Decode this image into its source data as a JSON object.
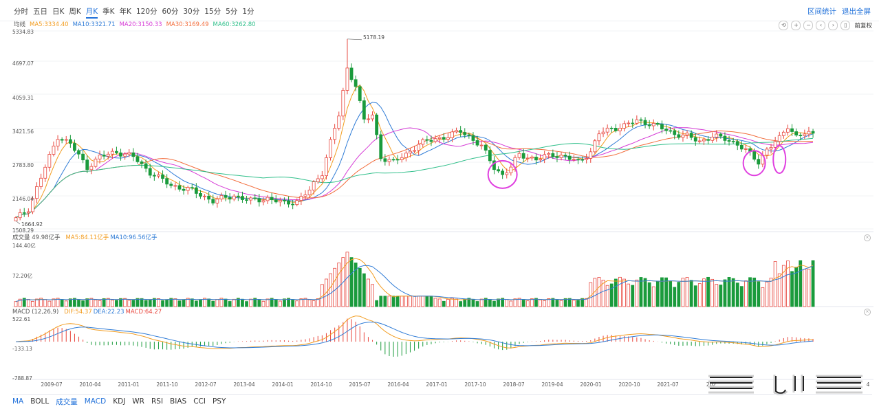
{
  "toolbar": {
    "periods": [
      {
        "label": "分时"
      },
      {
        "label": "五日"
      },
      {
        "label": "日K"
      },
      {
        "label": "周K"
      },
      {
        "label": "月K",
        "active": true
      },
      {
        "label": "季K"
      },
      {
        "label": "年K"
      },
      {
        "label": "120分"
      },
      {
        "label": "60分"
      },
      {
        "label": "30分"
      },
      {
        "label": "15分"
      },
      {
        "label": "5分"
      },
      {
        "label": "1分"
      }
    ],
    "range_stats": "区间统计",
    "exit_fullscreen": "退出全屏"
  },
  "ma_legend": {
    "title": "均线",
    "items": [
      {
        "text": "MA5:3334.40",
        "color": "#f29b1d"
      },
      {
        "text": "MA10:3321.71",
        "color": "#2e7bd6"
      },
      {
        "text": "MA20:3150.33",
        "color": "#d63bd6"
      },
      {
        "text": "MA30:3169.49",
        "color": "#f26b3a"
      },
      {
        "text": "MA60:3262.80",
        "color": "#2fbf8a"
      }
    ]
  },
  "tools": {
    "icons": [
      "undo-icon",
      "zoom-in-icon",
      "zoom-out-icon",
      "prev-icon",
      "next-icon",
      "reset-icon"
    ],
    "glyphs": [
      "⟲",
      "+",
      "−",
      "‹",
      "›",
      "▯"
    ],
    "adjust_label": "前复权"
  },
  "price_axis": [
    "5334.83",
    "4697.07",
    "4059.31",
    "3421.56",
    "2783.80",
    "2146.04",
    "1508.29"
  ],
  "price_notes": {
    "high": "5178.19",
    "low": "1664.92"
  },
  "volume_panel": {
    "title": "成交量 49.98亿手",
    "ma5": "MA5:84.11亿手",
    "ma10": "MA10:96.56亿手",
    "axis": [
      "144.40亿",
      "72.20亿"
    ]
  },
  "macd_panel": {
    "title": "MACD (12,26,9)",
    "dif": "DIF:54.37",
    "dea": "DEA:22.23",
    "macd": "MACD:64.27",
    "axis": [
      "522.61",
      "-133.13",
      "-788.87"
    ]
  },
  "date_axis": [
    "2009-07",
    "2010-04",
    "2011-01",
    "2011-10",
    "2012-07",
    "2013-04",
    "2014-01",
    "2014-10",
    "2015-07",
    "2016-04",
    "2017-01",
    "2017-10",
    "2018-07",
    "2019-04",
    "2020-01",
    "2020-10",
    "2021-07",
    "202",
    "4"
  ],
  "bottom_tabs": [
    {
      "label": "MA",
      "blue": true
    },
    {
      "label": "BOLL"
    },
    {
      "label": "成交量",
      "blue": true
    },
    {
      "label": "MACD",
      "blue": true
    },
    {
      "label": "KDJ"
    },
    {
      "label": "WR"
    },
    {
      "label": "RSI"
    },
    {
      "label": "BIAS"
    },
    {
      "label": "CCI"
    },
    {
      "label": "PSY"
    }
  ],
  "colors": {
    "up": "#e8453c",
    "down": "#1a9b3c",
    "accent": "#1e6fd9",
    "highlight_circle": "#e040e0"
  },
  "chart_data": {
    "type": "candlestick",
    "title": "",
    "y_range": [
      1508.29,
      5334.83
    ],
    "anchors": [
      [
        0,
        1700
      ],
      [
        3,
        1900
      ],
      [
        7,
        2700
      ],
      [
        10,
        3300
      ],
      [
        13,
        3150
      ],
      [
        17,
        2700
      ],
      [
        20,
        2900
      ],
      [
        24,
        3000
      ],
      [
        28,
        2900
      ],
      [
        32,
        2600
      ],
      [
        37,
        2350
      ],
      [
        42,
        2250
      ],
      [
        47,
        2050
      ],
      [
        52,
        2150
      ],
      [
        56,
        2050
      ],
      [
        60,
        2100
      ],
      [
        64,
        2000
      ],
      [
        67,
        2050
      ],
      [
        70,
        2250
      ],
      [
        73,
        2600
      ],
      [
        75,
        3200
      ],
      [
        77,
        3700
      ],
      [
        79,
        4600
      ],
      [
        81,
        4300
      ],
      [
        83,
        3600
      ],
      [
        85,
        3700
      ],
      [
        87,
        2900
      ],
      [
        90,
        2800
      ],
      [
        93,
        2950
      ],
      [
        96,
        3150
      ],
      [
        100,
        3250
      ],
      [
        103,
        3300
      ],
      [
        106,
        3400
      ],
      [
        108,
        3300
      ],
      [
        111,
        3100
      ],
      [
        114,
        2700
      ],
      [
        116,
        2550
      ],
      [
        118,
        2700
      ],
      [
        120,
        2950
      ],
      [
        124,
        2850
      ],
      [
        128,
        2950
      ],
      [
        131,
        2900
      ],
      [
        134,
        2800
      ],
      [
        137,
        3000
      ],
      [
        139,
        3350
      ],
      [
        142,
        3450
      ],
      [
        145,
        3500
      ],
      [
        148,
        3600
      ],
      [
        151,
        3550
      ],
      [
        154,
        3450
      ],
      [
        157,
        3350
      ],
      [
        160,
        3300
      ],
      [
        163,
        3200
      ],
      [
        166,
        3300
      ],
      [
        169,
        3250
      ],
      [
        172,
        3150
      ],
      [
        175,
        2950
      ],
      [
        177,
        2800
      ],
      [
        179,
        3050
      ],
      [
        182,
        3250
      ],
      [
        184,
        3500
      ],
      [
        186,
        3300
      ],
      [
        188,
        3350
      ],
      [
        190,
        3330
      ]
    ],
    "volume_range": [
      0,
      144.4
    ],
    "macd_range": [
      -788.87,
      522.61
    ],
    "highlight_circles": [
      {
        "x_index": 116,
        "price": 2560
      },
      {
        "x_index": 176,
        "price": 2780
      },
      {
        "x_index": 182,
        "price": 2850
      }
    ]
  }
}
